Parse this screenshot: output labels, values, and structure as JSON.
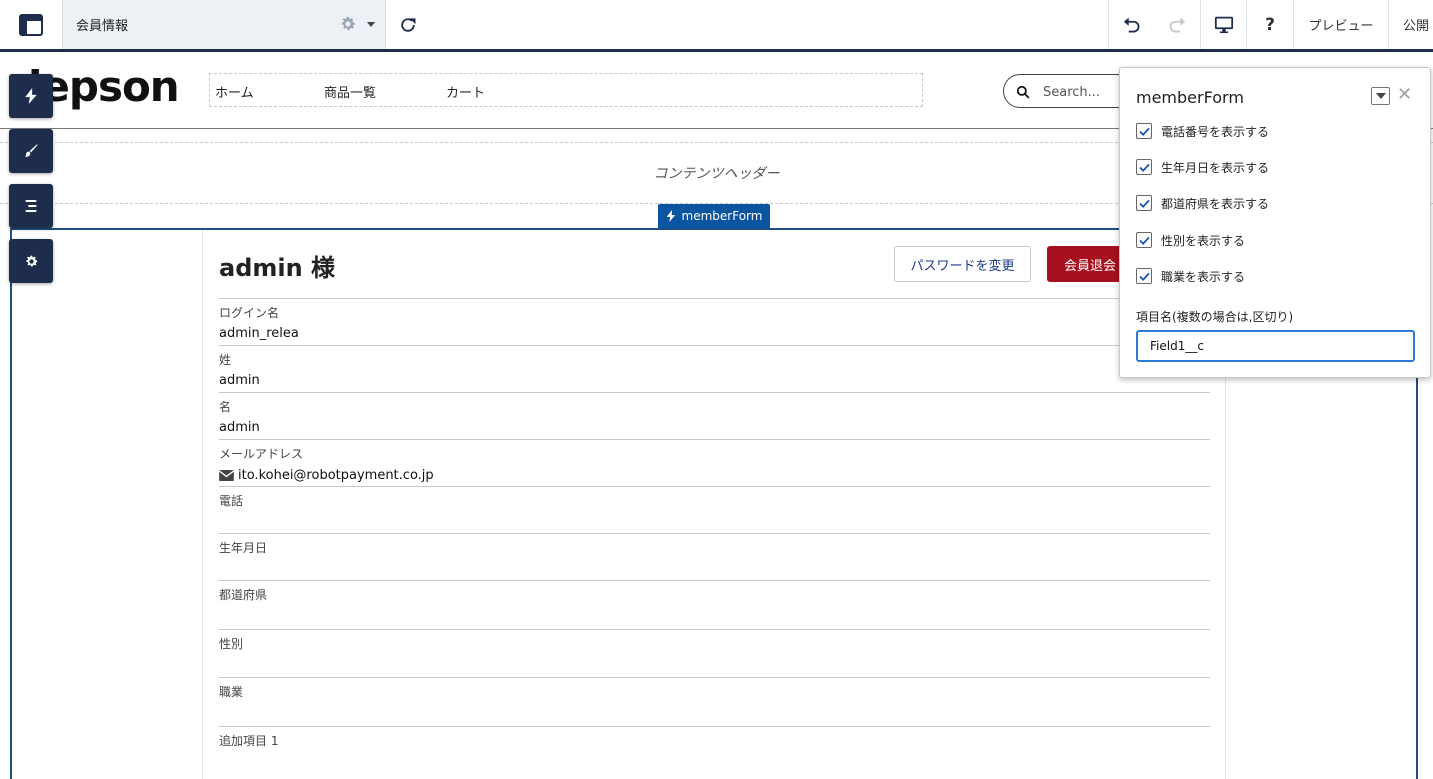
{
  "toolbar": {
    "page_title": "会員情報",
    "preview_label": "プレビュー",
    "publish_label": "公開",
    "help_label": "?"
  },
  "site": {
    "brand": "lepson",
    "nav": [
      {
        "label": "ホーム"
      },
      {
        "label": "商品一覧"
      },
      {
        "label": "カート"
      }
    ],
    "search_placeholder": "Search..."
  },
  "content_header": {
    "label": "コンテンツヘッダー"
  },
  "component": {
    "tag_label": "memberForm"
  },
  "member": {
    "title": "admin 様",
    "change_password_label": "パスワードを変更",
    "withdraw_label": "会員退会",
    "fields": [
      {
        "label": "ログイン名",
        "value": "admin_relea"
      },
      {
        "label": "姓",
        "value": "admin"
      },
      {
        "label": "名",
        "value": "admin"
      },
      {
        "label": "メールアドレス",
        "value": "ito.kohei@robotpayment.co.jp"
      },
      {
        "label": "電話",
        "value": ""
      },
      {
        "label": "生年月日",
        "value": ""
      },
      {
        "label": "都道府県",
        "value": ""
      },
      {
        "label": "性別",
        "value": ""
      },
      {
        "label": "職業",
        "value": ""
      },
      {
        "label": "追加項目 1",
        "value": ""
      }
    ]
  },
  "popover": {
    "title": "memberForm",
    "close_label": "✕",
    "checkboxes": [
      {
        "label": "電話番号を表示する",
        "checked": true
      },
      {
        "label": "生年月日を表示する",
        "checked": true
      },
      {
        "label": "都道府県を表示する",
        "checked": true
      },
      {
        "label": "性別を表示する",
        "checked": true
      },
      {
        "label": "職業を表示する",
        "checked": true
      }
    ],
    "field_label": "項目名(複数の場合は,区切り)",
    "field_value": "Field1__c"
  },
  "colors": {
    "toolbar_border": "#1f2d4d",
    "component_blue": "#0a55a0",
    "withdraw_red": "#a7101e",
    "input_focus": "#2d7ad6"
  }
}
